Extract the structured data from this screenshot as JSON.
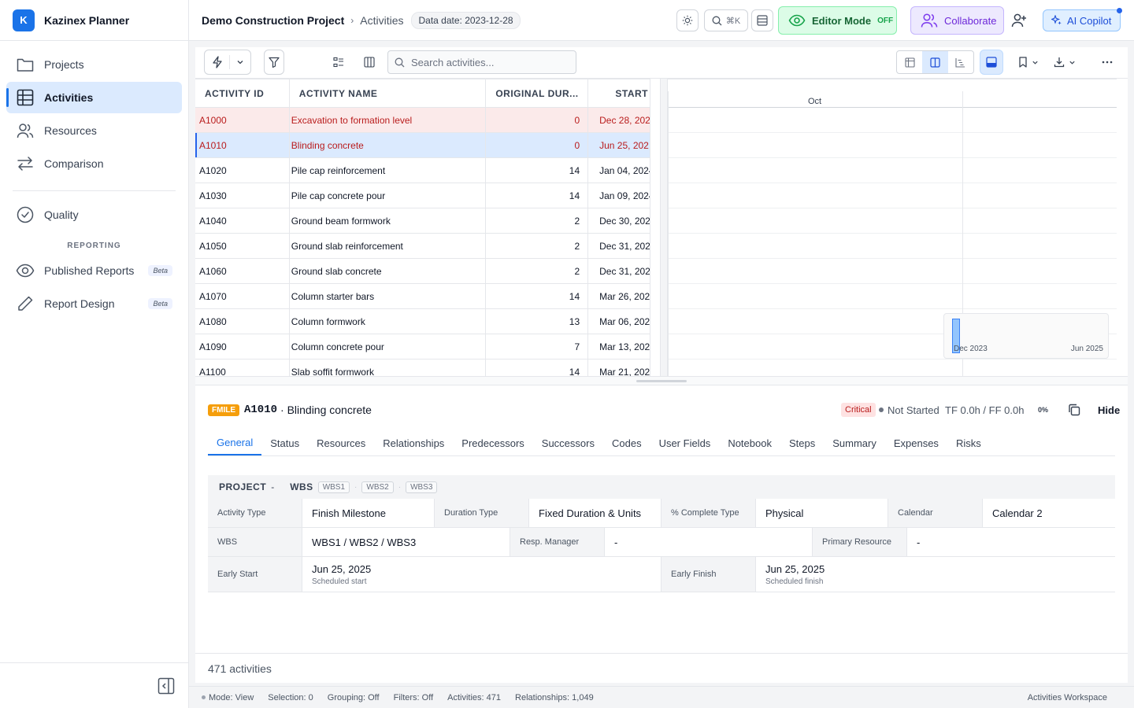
{
  "app": {
    "logo_letter": "K",
    "name": "Kazinex Planner"
  },
  "sidebar": {
    "items": [
      {
        "label": "Projects",
        "icon": "folder-icon"
      },
      {
        "label": "Activities",
        "icon": "table-icon",
        "active": true
      },
      {
        "label": "Resources",
        "icon": "users-icon"
      },
      {
        "label": "Comparison",
        "icon": "arrows-icon"
      },
      {
        "label": "Quality",
        "icon": "check-circle-icon"
      }
    ],
    "section_reporting": "REPORTING",
    "reporting_items": [
      {
        "label": "Published Reports",
        "badge": "Beta",
        "icon": "eye-icon"
      },
      {
        "label": "Report Design",
        "badge": "Beta",
        "icon": "pencil-icon"
      }
    ]
  },
  "header": {
    "project": "Demo Construction Project",
    "separator": "›",
    "page": "Activities",
    "data_date": "Data date: 2023-12-28",
    "search_shortcut": "⌘K",
    "editor_mode_label": "Editor Mode",
    "editor_mode_state": "OFF",
    "collaborate_label": "Collaborate",
    "copilot_label": "AI Copilot"
  },
  "toolbar": {
    "search_placeholder": "Search activities..."
  },
  "table": {
    "columns": [
      "ACTIVITY ID",
      "ACTIVITY NAME",
      "ORIGINAL DUR...",
      "START"
    ],
    "rows": [
      {
        "id": "A1000",
        "name": "Excavation to formation level",
        "dur": "0",
        "start": "Dec 28, 202",
        "state": "crit"
      },
      {
        "id": "A1010",
        "name": "Blinding concrete",
        "dur": "0",
        "start": "Jun 25, 202",
        "state": "sel"
      },
      {
        "id": "A1020",
        "name": "Pile cap reinforcement",
        "dur": "14",
        "start": "Jan 04, 2024",
        "state": ""
      },
      {
        "id": "A1030",
        "name": "Pile cap concrete pour",
        "dur": "14",
        "start": "Jan 09, 2024",
        "state": ""
      },
      {
        "id": "A1040",
        "name": "Ground beam formwork",
        "dur": "2",
        "start": "Dec 30, 202",
        "state": ""
      },
      {
        "id": "A1050",
        "name": "Ground slab reinforcement",
        "dur": "2",
        "start": "Dec 31, 202",
        "state": ""
      },
      {
        "id": "A1060",
        "name": "Ground slab concrete",
        "dur": "2",
        "start": "Dec 31, 202",
        "state": ""
      },
      {
        "id": "A1070",
        "name": "Column starter bars",
        "dur": "14",
        "start": "Mar 26, 202",
        "state": ""
      },
      {
        "id": "A1080",
        "name": "Column formwork",
        "dur": "13",
        "start": "Mar 06, 202",
        "state": ""
      },
      {
        "id": "A1090",
        "name": "Column concrete pour",
        "dur": "7",
        "start": "Mar 13, 202",
        "state": ""
      },
      {
        "id": "A1100",
        "name": "Slab soffit formwork",
        "dur": "14",
        "start": "Mar 21, 202",
        "state": ""
      }
    ]
  },
  "gantt": {
    "month_label": "Oct",
    "overview_start": "Dec 2023",
    "overview_end": "Jun 2025"
  },
  "detail": {
    "type_badge": "FMILE",
    "activity_id": "A1010",
    "activity_name": "· Blinding concrete",
    "critical": "Critical",
    "status": "Not Started",
    "float": "TF 0.0h / FF 0.0h",
    "percent": "0%",
    "hide_label": "Hide",
    "tabs": [
      "General",
      "Status",
      "Resources",
      "Relationships",
      "Predecessors",
      "Successors",
      "Codes",
      "User Fields",
      "Notebook",
      "Steps",
      "Summary",
      "Expenses",
      "Risks"
    ],
    "path": {
      "project_label": "PROJECT",
      "project_value": "-",
      "wbs_label": "WBS",
      "wbs_chips": [
        "WBS1",
        "WBS2",
        "WBS3"
      ],
      "chip_sep": "·"
    },
    "fields": {
      "activity_type_label": "Activity Type",
      "activity_type": "Finish Milestone",
      "duration_type_label": "Duration Type",
      "duration_type": "Fixed Duration & Units",
      "pct_type_label": "% Complete Type",
      "pct_type": "Physical",
      "calendar_label": "Calendar",
      "calendar": "Calendar 2",
      "wbs_label": "WBS",
      "wbs": "WBS1 / WBS2 / WBS3",
      "resp_label": "Resp. Manager",
      "resp": "-",
      "primary_res_label": "Primary Resource",
      "primary_res": "-",
      "early_start_label": "Early Start",
      "early_start": "Jun 25, 2025",
      "early_start_sub": "Scheduled start",
      "early_finish_label": "Early Finish",
      "early_finish": "Jun 25, 2025",
      "early_finish_sub": "Scheduled finish"
    }
  },
  "footer": {
    "count": "471 activities"
  },
  "statusbar": {
    "mode": "Mode: View",
    "selection": "Selection: 0",
    "grouping": "Grouping: Off",
    "filters": "Filters: Off",
    "activities": "Activities: 471",
    "relationships": "Relationships: 1,049",
    "workspace": "Activities Workspace"
  },
  "colors": {
    "accent": "#1a73e8",
    "critical": "#b91c1c",
    "selected_row": "#dbeafe",
    "critical_row": "#fbeaea",
    "milestone": "#f59e0b"
  }
}
